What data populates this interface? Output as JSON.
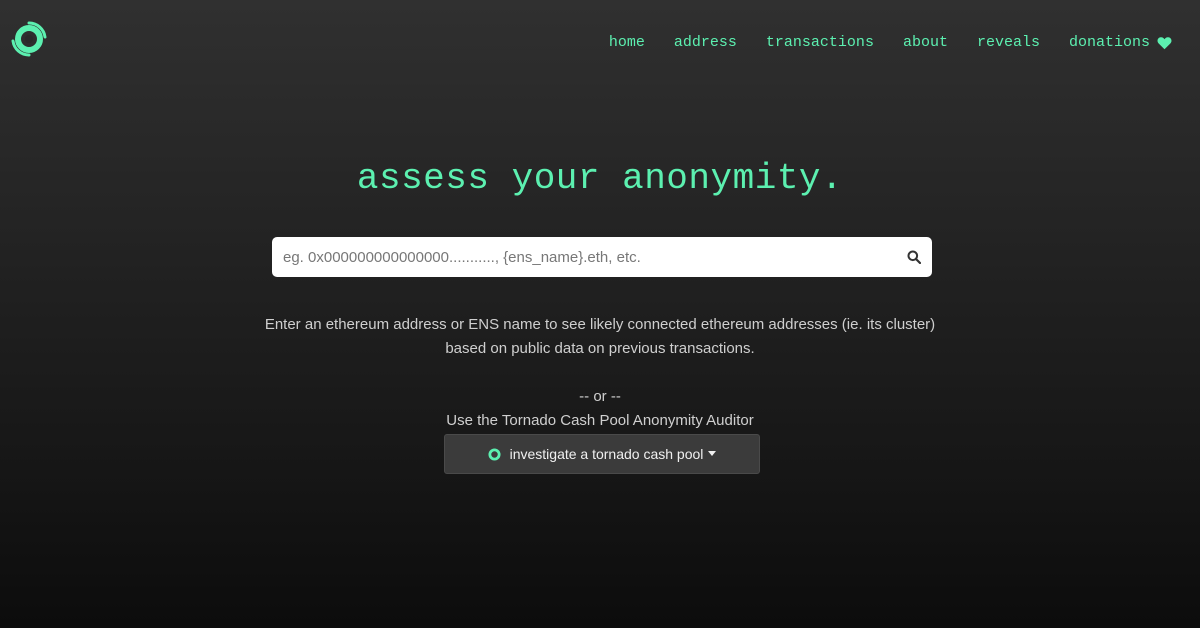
{
  "logo": {
    "icon": "tornado-logo-icon",
    "color": "#5cf0b0"
  },
  "nav": {
    "items": [
      {
        "label": "home"
      },
      {
        "label": "address"
      },
      {
        "label": "transactions"
      },
      {
        "label": "about"
      },
      {
        "label": "reveals"
      },
      {
        "label": "donations",
        "icon": "heart-icon"
      }
    ]
  },
  "hero": {
    "title": "assess your anonymity."
  },
  "search": {
    "placeholder": "eg. 0x000000000000000..........., {ens_name}.eth, etc.",
    "value": "",
    "icon": "search-icon"
  },
  "description": {
    "line1": "Enter an ethereum address or ENS name to see likely connected ethereum addresses (ie. its cluster)",
    "line2": "based on public data on previous transactions."
  },
  "alternative": {
    "separator": "-- or --",
    "auditor_label": "Use the Tornado Cash Pool Anonymity Auditor",
    "pool_button_label": "investigate a tornado cash pool",
    "pool_button_icon": "tornado-icon"
  },
  "colors": {
    "accent": "#5cf0b0",
    "background": "#1e1e1e",
    "button_bg": "#3b3b3b"
  }
}
